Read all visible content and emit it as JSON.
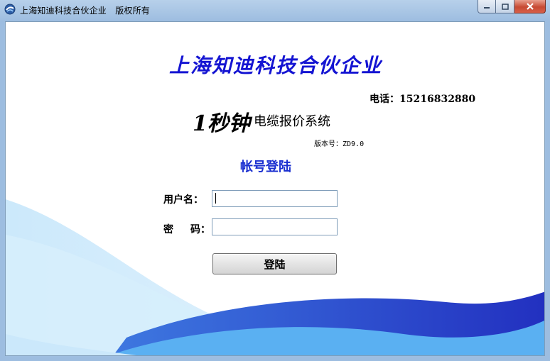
{
  "window": {
    "title": "上海知迪科技合伙企业　版权所有",
    "icons": {
      "app": "app-logo-icon",
      "minimize": "minimize-icon",
      "maximize": "maximize-icon",
      "close": "close-icon"
    }
  },
  "header": {
    "company": "上海知迪科技合伙企业",
    "phone": "电话：15216832880",
    "logo_prefix": "1秒钟",
    "system_name": "电缆报价系统",
    "version_label": "版本号：",
    "version_value": "ZD9.0"
  },
  "login": {
    "heading": "帐号登陆",
    "username_label": "用户名：",
    "password_label_1": "密",
    "password_label_2": "码：",
    "username_value": "",
    "password_value": "",
    "submit_label": "登陆"
  },
  "colors": {
    "company_title": "#1414d2",
    "heading": "#1a2fd0",
    "wave_dark": "#2a3fc8",
    "wave_light": "#5aaef0"
  }
}
